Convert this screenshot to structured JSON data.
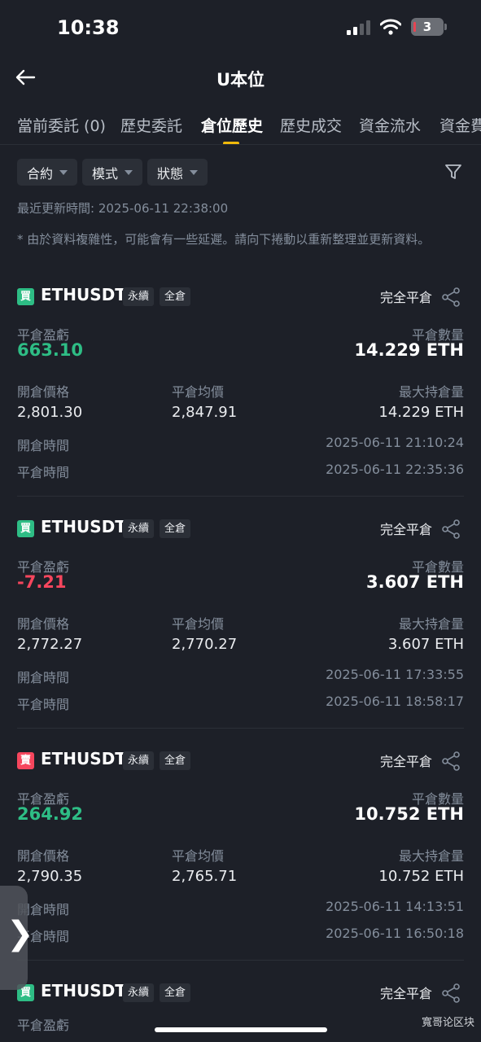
{
  "status_bar": {
    "time": "10:38",
    "battery": "3"
  },
  "nav": {
    "title": "U本位"
  },
  "tabs": [
    {
      "label": "當前委託 (0)"
    },
    {
      "label": "歷史委託"
    },
    {
      "label": "倉位歷史"
    },
    {
      "label": "歷史成交"
    },
    {
      "label": "資金流水"
    },
    {
      "label": "資金費"
    }
  ],
  "active_tab": "倉位歷史",
  "filters": [
    {
      "label": "合約"
    },
    {
      "label": "模式"
    },
    {
      "label": "狀態"
    }
  ],
  "last_updated": "最近更新時間: 2025-06-11 22:38:00",
  "note": "* 由於資料複雜性，可能會有一些延遲。請向下捲動以重新整理並更新資料。",
  "labels": {
    "pnl": "平倉盈虧",
    "close_qty": "平倉數量",
    "open_price": "開倉價格",
    "close_avg": "平倉均價",
    "max_hold": "最大持倉量",
    "open_time": "開倉時間",
    "close_time": "平倉時間"
  },
  "positions": [
    {
      "side": "買",
      "side_type": "buy",
      "symbol": "ETHUSDT",
      "type_tag": "永續",
      "margin_tag": "全倉",
      "status": "完全平倉",
      "pnl": "663.10",
      "pnl_dir": "up",
      "close_qty": "14.229 ETH",
      "open_price": "2,801.30",
      "close_avg": "2,847.91",
      "max_hold": "14.229 ETH",
      "open_time": "2025-06-11 21:10:24",
      "close_time": "2025-06-11 22:35:36"
    },
    {
      "side": "買",
      "side_type": "buy",
      "symbol": "ETHUSDT",
      "type_tag": "永續",
      "margin_tag": "全倉",
      "status": "完全平倉",
      "pnl": "-7.21",
      "pnl_dir": "down",
      "close_qty": "3.607 ETH",
      "open_price": "2,772.27",
      "close_avg": "2,770.27",
      "max_hold": "3.607 ETH",
      "open_time": "2025-06-11 17:33:55",
      "close_time": "2025-06-11 18:58:17"
    },
    {
      "side": "賣",
      "side_type": "sell",
      "symbol": "ETHUSDT",
      "type_tag": "永續",
      "margin_tag": "全倉",
      "status": "完全平倉",
      "pnl": "264.92",
      "pnl_dir": "up",
      "close_qty": "10.752 ETH",
      "open_price": "2,790.35",
      "close_avg": "2,765.71",
      "max_hold": "10.752 ETH",
      "open_time": "2025-06-11 14:13:51",
      "close_time": "2025-06-11 16:50:18"
    },
    {
      "side": "買",
      "side_type": "buy",
      "symbol": "ETHUSDT",
      "type_tag": "永續",
      "margin_tag": "全倉",
      "status": "完全平倉",
      "pnl_label_only": true
    }
  ],
  "watermark": "寬哥论区块",
  "colors": {
    "up": "#2ebd85",
    "down": "#f6465d",
    "accent": "#f0b90b",
    "background": "#1d2028"
  }
}
